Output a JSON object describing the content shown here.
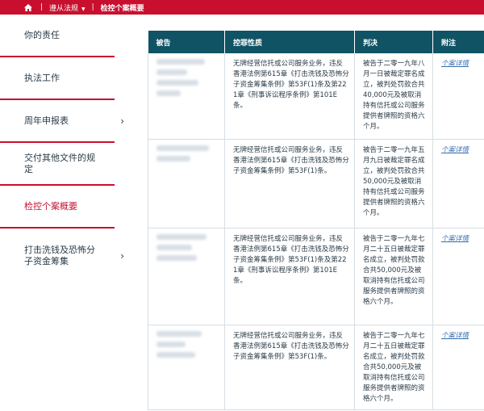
{
  "topbar": {
    "crumb1": "遵从法规",
    "crumb2": "检控个案概要"
  },
  "sidebar": {
    "items": [
      {
        "label": "你的责任"
      },
      {
        "label": "执法工作"
      },
      {
        "label": "周年申报表"
      },
      {
        "label": "交付其他文件的规定"
      },
      {
        "label": "检控个案概要"
      },
      {
        "label": "打击洗钱及恐怖分子资金筹集"
      }
    ]
  },
  "table": {
    "headers": [
      "被告",
      "控罪性质",
      "判决",
      "附注"
    ],
    "rows": [
      {
        "charge": "无牌经营信托或公司服务业务，违反香港法例第615章《打击洗钱及恐怖分子资金筹集条例》第53F(1)条及第221章《刑事诉讼程序条例》第101E条。",
        "verdict": "被告于二零一九年八月一日被裁定罪名成立，被判处罚款合共40,000元及被取消持有信托或公司服务提供者牌照的资格六个月。",
        "note": "个案详情"
      },
      {
        "charge": "无牌经营信托或公司服务业务，违反香港法例第615章《打击洗钱及恐怖分子资金筹集条例》第53F(1)条。",
        "verdict": "被告于二零一九年五月九日被裁定罪名成立，被判处罚款合共50,000元及被取消持有信托或公司服务提供者牌照的资格六个月。",
        "note": "个案详情"
      },
      {
        "charge": "无牌经营信托或公司服务业务，违反香港法例第615章《打击洗钱及恐怖分子资金筹集条例》第53F(1)条及第221章《刑事诉讼程序条例》第101E条。",
        "verdict": "被告于二零一九年七月二十五日被裁定罪名成立，被判处罚款合共50,000元及被取消持有信托或公司服务提供者牌照的资格六个月。",
        "note": "个案详情"
      },
      {
        "charge": "无牌经营信托或公司服务业务，违反香港法例第615章《打击洗钱及恐怖分子资金筹集条例》第53F(1)条。",
        "verdict": "被告于二零一九年七月二十五日被裁定罪名成立，被判处罚款合共50,000元及被取消持有信托或公司服务提供者牌照的资格六个月。",
        "note": "个案详情"
      }
    ]
  },
  "colors": {
    "brand_red": "#c8102e",
    "header_teal": "#0f5364",
    "link_blue": "#3a6fb0"
  },
  "icons": {
    "home": "home-icon",
    "caret": "caret-down-icon",
    "chevron": "chevron-right-icon"
  }
}
